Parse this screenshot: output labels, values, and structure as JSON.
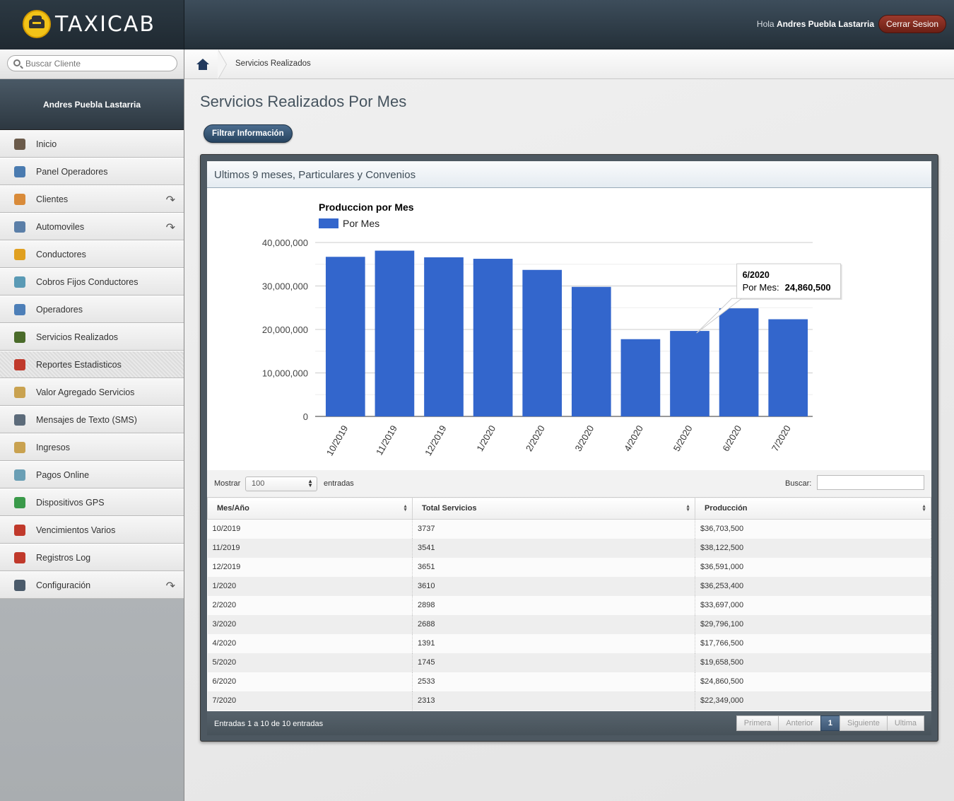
{
  "header": {
    "logo_text": "TAXICAB",
    "greeting_prefix": "Hola",
    "user_name": "Andres Puebla Lastarria",
    "logout_label": "Cerrar Sesion"
  },
  "sidebar": {
    "search_placeholder": "Buscar Cliente",
    "user_name": "Andres Puebla Lastarria",
    "items": [
      {
        "label": "Inicio",
        "icon": "dashboard-icon",
        "color": "#6b5b4b",
        "arrow": false
      },
      {
        "label": "Panel Operadores",
        "icon": "monitor-icon",
        "color": "#4a7bb0",
        "arrow": false
      },
      {
        "label": "Clientes",
        "icon": "users-icon",
        "color": "#d98b3a",
        "arrow": true
      },
      {
        "label": "Automoviles",
        "icon": "car-icon",
        "color": "#5b7fa8",
        "arrow": true
      },
      {
        "label": "Conductores",
        "icon": "driver-icon",
        "color": "#e0a020",
        "arrow": false
      },
      {
        "label": "Cobros Fijos Conductores",
        "icon": "ledger-icon",
        "color": "#5a9ab5",
        "arrow": false
      },
      {
        "label": "Operadores",
        "icon": "operator-icon",
        "color": "#4d7fb8",
        "arrow": false
      },
      {
        "label": "Servicios Realizados",
        "icon": "road-icon",
        "color": "#4a6b2a",
        "arrow": false
      },
      {
        "label": "Reportes Estadisticos",
        "icon": "bar-chart-icon",
        "color": "#c0392b",
        "arrow": false
      },
      {
        "label": "Valor Agregado Servicios",
        "icon": "box-icon",
        "color": "#c9a250",
        "arrow": false
      },
      {
        "label": "Mensajes de Texto (SMS)",
        "icon": "phone-icon",
        "color": "#5c6b7a",
        "arrow": false
      },
      {
        "label": "Ingresos",
        "icon": "money-icon",
        "color": "#c9a250",
        "arrow": false
      },
      {
        "label": "Pagos Online",
        "icon": "payment-icon",
        "color": "#6a9fb5",
        "arrow": false
      },
      {
        "label": "Dispositivos GPS",
        "icon": "gps-icon",
        "color": "#3a9a4a",
        "arrow": false
      },
      {
        "label": "Vencimientos Varios",
        "icon": "calendar-icon",
        "color": "#c0392b",
        "arrow": false
      },
      {
        "label": "Registros Log",
        "icon": "book-icon",
        "color": "#c0392b",
        "arrow": false
      },
      {
        "label": "Configuración",
        "icon": "settings-icon",
        "color": "#4a5a6a",
        "arrow": true
      }
    ],
    "active_index": 8
  },
  "breadcrumb": {
    "current": "Servicios Realizados"
  },
  "page": {
    "title": "Servicios Realizados Por Mes",
    "filter_button": "Filtrar Información",
    "widget_title": "Ultimos 9 meses, Particulares y Convenios"
  },
  "chart_data": {
    "type": "bar",
    "title": "Produccion por Mes",
    "series": [
      {
        "name": "Por Mes",
        "color": "#3366cc",
        "values": [
          36703500,
          38122500,
          36591000,
          36253400,
          33697000,
          29796100,
          17766500,
          19658500,
          24860500,
          22349000
        ]
      }
    ],
    "categories": [
      "10/2019",
      "11/2019",
      "12/2019",
      "1/2020",
      "2/2020",
      "3/2020",
      "4/2020",
      "5/2020",
      "6/2020",
      "7/2020"
    ],
    "yticks": [
      "0",
      "10,000,000",
      "20,000,000",
      "30,000,000",
      "40,000,000"
    ],
    "ylim": [
      0,
      40000000
    ],
    "tooltip": {
      "title": "6/2020",
      "label": "Por Mes:",
      "value": "24,860,500"
    },
    "grid": true,
    "legend": "top-left"
  },
  "table": {
    "show_label": "Mostrar",
    "show_value": "100",
    "entries_label": "entradas",
    "search_label": "Buscar:",
    "columns": [
      "Mes/Año",
      "Total Servicios",
      "Producción"
    ],
    "rows": [
      [
        "10/2019",
        "3737",
        "$36,703,500"
      ],
      [
        "11/2019",
        "3541",
        "$38,122,500"
      ],
      [
        "12/2019",
        "3651",
        "$36,591,000"
      ],
      [
        "1/2020",
        "3610",
        "$36,253,400"
      ],
      [
        "2/2020",
        "2898",
        "$33,697,000"
      ],
      [
        "3/2020",
        "2688",
        "$29,796,100"
      ],
      [
        "4/2020",
        "1391",
        "$17,766,500"
      ],
      [
        "5/2020",
        "1745",
        "$19,658,500"
      ],
      [
        "6/2020",
        "2533",
        "$24,860,500"
      ],
      [
        "7/2020",
        "2313",
        "$22,349,000"
      ]
    ],
    "info": "Entradas 1 a 10 de 10 entradas",
    "pager": {
      "first": "Primera",
      "prev": "Anterior",
      "current": "1",
      "next": "Siguiente",
      "last": "Ultima"
    }
  }
}
